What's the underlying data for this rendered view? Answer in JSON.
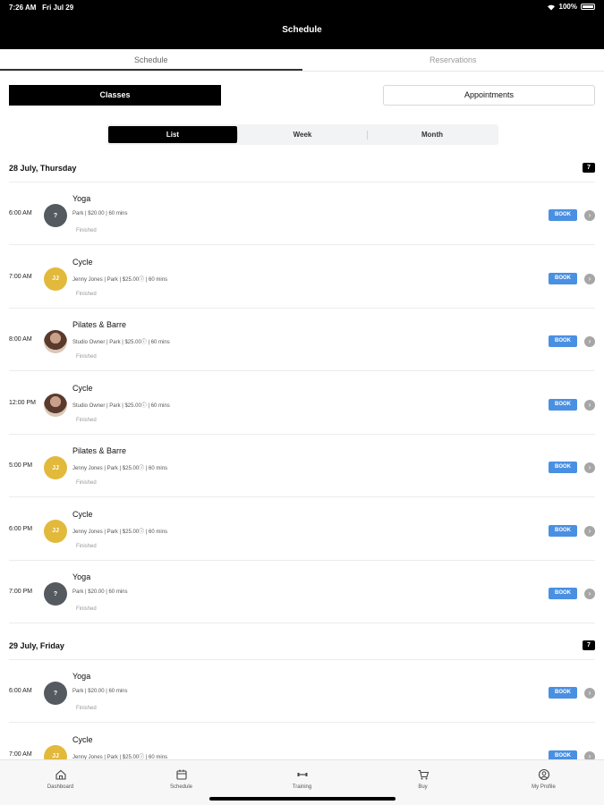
{
  "status_bar": {
    "time": "7:26 AM",
    "date": "Fri Jul 29",
    "battery": "100%"
  },
  "header": {
    "title": "Schedule"
  },
  "tabs": [
    {
      "label": "Schedule",
      "active": true
    },
    {
      "label": "Reservations",
      "active": false
    }
  ],
  "mode_buttons": {
    "classes": "Classes",
    "appointments": "Appointments"
  },
  "view_switch": [
    {
      "label": "List",
      "active": true
    },
    {
      "label": "Week",
      "active": false
    },
    {
      "label": "Month",
      "active": false
    }
  ],
  "days": [
    {
      "title": "28 July, Thursday",
      "badge": "7",
      "classes": [
        {
          "time": "6:00 AM",
          "avatar": "grey",
          "avatar_text": "?",
          "name": "Yoga",
          "meta": "Park | $20.00 | 60 mins",
          "status": "Finished",
          "button": "BOOK"
        },
        {
          "time": "7:00 AM",
          "avatar": "yellow",
          "avatar_text": "JJ",
          "name": "Cycle",
          "meta": "Jenny Jones | Park | $25.00ⓘ | 60 mins",
          "status": "Finished",
          "button": "BOOK"
        },
        {
          "time": "8:00 AM",
          "avatar": "photo",
          "avatar_text": "",
          "name": "Pilates & Barre",
          "meta": "Studio Owner | Park | $25.00ⓘ | 60 mins",
          "status": "Finished",
          "button": "BOOK"
        },
        {
          "time": "12:00 PM",
          "avatar": "photo",
          "avatar_text": "",
          "name": "Cycle",
          "meta": "Studio Owner | Park | $25.00ⓘ | 60 mins",
          "status": "Finished",
          "button": "BOOK"
        },
        {
          "time": "5:00 PM",
          "avatar": "yellow",
          "avatar_text": "JJ",
          "name": "Pilates & Barre",
          "meta": "Jenny Jones | Park | $25.00ⓘ | 60 mins",
          "status": "Finished",
          "button": "BOOK"
        },
        {
          "time": "6:00 PM",
          "avatar": "yellow",
          "avatar_text": "JJ",
          "name": "Cycle",
          "meta": "Jenny Jones | Park | $25.00ⓘ | 60 mins",
          "status": "Finished",
          "button": "BOOK"
        },
        {
          "time": "7:00 PM",
          "avatar": "grey",
          "avatar_text": "?",
          "name": "Yoga",
          "meta": "Park | $20.00 | 60 mins",
          "status": "Finished",
          "button": "BOOK"
        }
      ]
    },
    {
      "title": "29 July, Friday",
      "badge": "7",
      "classes": [
        {
          "time": "6:00 AM",
          "avatar": "grey",
          "avatar_text": "?",
          "name": "Yoga",
          "meta": "Park | $20.00 | 60 mins",
          "status": "Finished",
          "button": "BOOK"
        },
        {
          "time": "7:00 AM",
          "avatar": "yellow",
          "avatar_text": "JJ",
          "name": "Cycle",
          "meta": "Jenny Jones | Park | $25.00ⓘ | 60 mins",
          "status": "",
          "button": "BOOK"
        }
      ]
    }
  ],
  "bottom_nav": [
    {
      "label": "Dashboard",
      "icon": "home-icon"
    },
    {
      "label": "Schedule",
      "icon": "calendar-icon"
    },
    {
      "label": "Training",
      "icon": "dumbbell-icon"
    },
    {
      "label": "Buy",
      "icon": "cart-icon"
    },
    {
      "label": "My Profile",
      "icon": "profile-icon"
    }
  ],
  "colors": {
    "accent": "#4a90e2",
    "header_bg": "#000000",
    "avatar_yellow": "#e2b93b",
    "avatar_grey": "#555a60"
  }
}
